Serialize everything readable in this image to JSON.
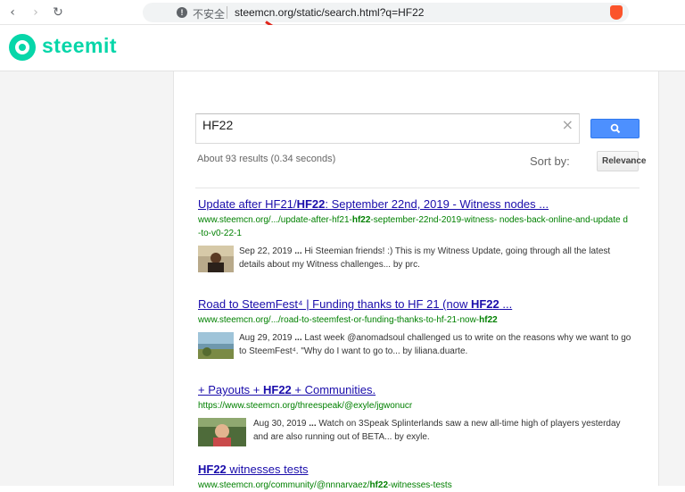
{
  "browser": {
    "back_icon": "‹",
    "forward_icon": "›",
    "reload_icon": "↻",
    "bookmark_icon": "❐",
    "insecure_label": "不安全",
    "url": "steemcn.org/static/search.html?q=HF22"
  },
  "site": {
    "logo_text": "steemit"
  },
  "search": {
    "query": "HF22",
    "clear_icon": "×"
  },
  "stats": "About 93 results (0.34 seconds)",
  "sort": {
    "label": "Sort by:",
    "value": "Relevance"
  },
  "results": [
    {
      "title_a": "Update after HF21/",
      "title_b": "HF22",
      "title_c": ": September 22nd, 2019 - Witness nodes ...",
      "url_a": "www.steemcn.org/.../update-after-hf21-",
      "url_b": "hf22",
      "url_c": "-september-22nd-2019-witness- nodes-back-online-and-update d-to-v0-22-1",
      "date": "Sep 22, 2019",
      "dots": " ... ",
      "snippet": "Hi Steemian friends! :) This is my Witness Update, going through all the latest details about my Witness challenges... by prc."
    },
    {
      "title_a": "Road to SteemFest⁴ | Funding thanks to HF 21 (now ",
      "title_b": "HF22",
      "title_c": " ...",
      "url_a": "www.steemcn.org/.../road-to-steemfest-or-funding-thanks-to-hf-21-now-",
      "url_b": "hf22",
      "url_c": "",
      "date": "Aug 29, 2019",
      "dots": " ... ",
      "snippet": "Last week @anomadsoul challenged us to write on the reasons why we want to go to SteemFest⁴. \"Why do I want to go to... by liliana.duarte."
    },
    {
      "title_a": "+ Payouts + ",
      "title_b": "HF22",
      "title_c": " + Communities.",
      "url_a": "https://www.steemcn.org/threespeak/@exyle/jgwonucr",
      "url_b": "",
      "url_c": "",
      "date": "Aug 30, 2019",
      "dots": " ... ",
      "snippet": "Watch on 3Speak Splinterlands saw a new all-time high of players yesterday and are also running out of BETA... by exyle."
    },
    {
      "title_a": "",
      "title_b": "HF22",
      "title_c": " witnesses tests",
      "url_a": "www.steemcn.org/community/@nnnarvaez/",
      "url_b": "hf22",
      "url_c": "-witnesses-tests"
    }
  ]
}
